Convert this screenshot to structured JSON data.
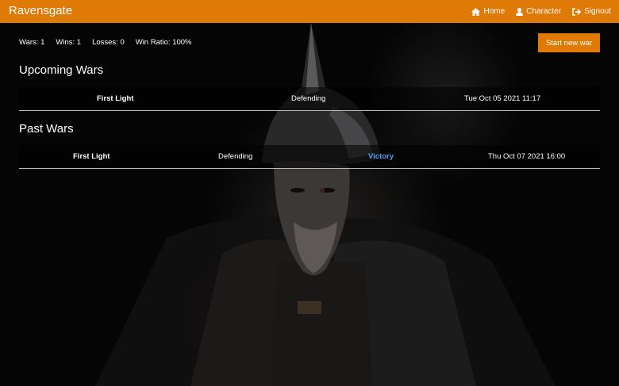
{
  "navbar": {
    "brand": "Ravensgate",
    "items": [
      {
        "label": "Home",
        "icon": "home-icon"
      },
      {
        "label": "Character",
        "icon": "user-icon"
      },
      {
        "label": "Signout",
        "icon": "signout-icon"
      }
    ]
  },
  "stats": {
    "wars": "Wars: 1",
    "wins": "Wins: 1",
    "losses": "Losses: 0",
    "ratio": "Win Ratio: 100%"
  },
  "actions": {
    "start_new_war": "Start new war"
  },
  "upcoming": {
    "title": "Upcoming Wars",
    "rows": [
      {
        "name": "First Light",
        "role": "Defending",
        "date": "Tue Oct 05 2021 11:17"
      }
    ]
  },
  "past": {
    "title": "Past Wars",
    "rows": [
      {
        "name": "First Light",
        "role": "Defending",
        "result": "Victory",
        "date": "Thu Oct 07 2021 16:00"
      }
    ]
  },
  "colors": {
    "accent": "#e07a06",
    "victory": "#5b9df0",
    "background": "#050505"
  }
}
